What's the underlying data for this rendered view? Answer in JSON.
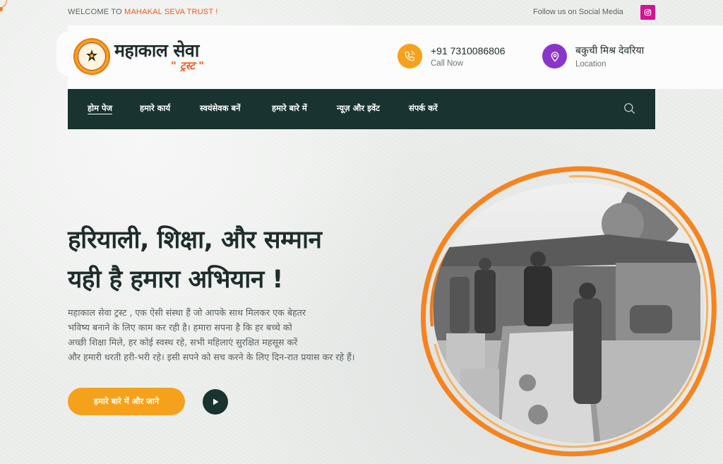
{
  "topbar": {
    "welcome_prefix": "WELCOME TO ",
    "welcome_brand": "MAHAKAL SEVA TRUST !",
    "follow_text": "Follow us on Social Media",
    "social_icon": "instagram-icon"
  },
  "header": {
    "logo_title": "महाकाल सेवा",
    "logo_subtitle": "\" ट्रस्ट \"",
    "phone": {
      "value": "+91 7310086806",
      "label": "Call Now",
      "icon": "phone-icon"
    },
    "location": {
      "value": "बकुची मिश्र देवरिया",
      "label": "Location",
      "icon": "location-pin-icon"
    }
  },
  "nav": {
    "items": [
      {
        "label": "होम पेज",
        "active": true
      },
      {
        "label": "हमारे कार्य"
      },
      {
        "label": "स्वयंसेवक बनें"
      },
      {
        "label": "हमारे बारे में"
      },
      {
        "label": "न्यूज़ और इवेंट"
      },
      {
        "label": "संपर्क करें"
      }
    ],
    "search_icon": "search-icon"
  },
  "hero": {
    "title_line1": "हरियाली, शिक्षा, और सम्मान",
    "title_line2": "यही है हमारा अभियान !",
    "desc_line1": "महाकाल सेवा ट्रस्ट , एक ऐसी संस्था हैं जो आपके साथ मिलकर एक बेहतर",
    "desc_line2": "भविष्य बनाने के लिए काम कर रही है। हमारा सपना है कि हर बच्चे को",
    "desc_line3": "अच्छी शिक्षा मिले, हर कोई स्वस्थ रहे, सभी महिलाएं सुरक्षित महसूस करें",
    "desc_line4": "और हमारी धरती हरी-भरी रहे। इसी सपने को सच करने के लिए दिन-रात प्रयास कर रहे हैं।",
    "cta_label": "हमारे बारे में और जाने",
    "play_icon": "play-icon"
  },
  "colors": {
    "accent_orange": "#f6a11b",
    "brand_red": "#f15a22",
    "nav_dark": "#183330",
    "instagram": "#d4148f",
    "location_purple": "#8a35c9"
  }
}
